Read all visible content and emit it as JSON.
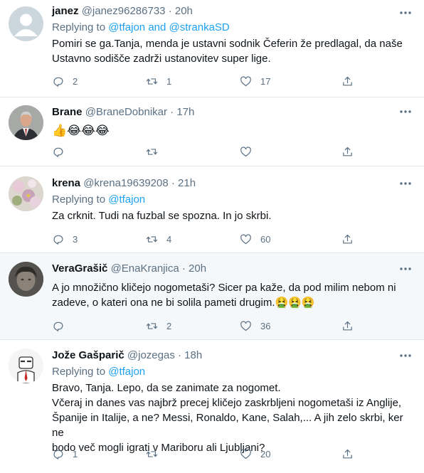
{
  "replying_label": "Replying to",
  "and_word": "and",
  "tweets": [
    {
      "name": "janez",
      "handle": "@janez96286733",
      "dot": "·",
      "time": "20h",
      "mentions": [
        "@tfajon",
        "@strankaSD"
      ],
      "lines": [
        "Pomiri se ga.Tanja, menda je ustavni sodnik Čeferin že predlagal, da naše",
        "Ustavno sodišče zadrži ustanovitev super lige."
      ],
      "replies": "2",
      "retweets": "1",
      "likes": "17"
    },
    {
      "name": "Brane",
      "handle": "@BraneDobnikar",
      "dot": "·",
      "time": "17h",
      "emoji_text": "👍😂😂😂",
      "replies": "",
      "retweets": "",
      "likes": ""
    },
    {
      "name": "krena",
      "handle": "@krena19639208",
      "dot": "·",
      "time": "21h",
      "mentions": [
        "@tfajon"
      ],
      "lines": [
        "Za crknit. Tudi na fuzbal se spozna. In jo skrbi."
      ],
      "replies": "3",
      "retweets": "4",
      "likes": "60"
    },
    {
      "name": "VeraGrašič",
      "handle": "@EnaKranjica",
      "dot": "·",
      "time": "20h",
      "lines": [
        "A jo množično kličejo nogometaši? Sicer pa kaže, da pod milim nebom ni",
        "zadeve, o kateri ona ne bi solila pameti drugim."
      ],
      "line_emoji": "🤮🤮🤮",
      "replies": "",
      "retweets": "2",
      "likes": "36"
    },
    {
      "name": "Jože Gašparič",
      "handle": "@jozegas",
      "dot": "·",
      "time": "18h",
      "mentions": [
        "@tfajon"
      ],
      "lines": [
        "Bravo, Tanja. Lepo, da se zanimate za nogomet.",
        "Včeraj in danes vas najbrž precej kličejo zaskrbljeni nogometaši iz Anglije,",
        "Španije in Italije, a ne? Messi, Ronaldo, Kane, Salah,... A jih zelo skrbi, ker ne",
        "bodo več mogli igrati v Mariboru ali Ljubljani?"
      ],
      "replies": "1",
      "retweets": "",
      "likes": "20"
    }
  ]
}
